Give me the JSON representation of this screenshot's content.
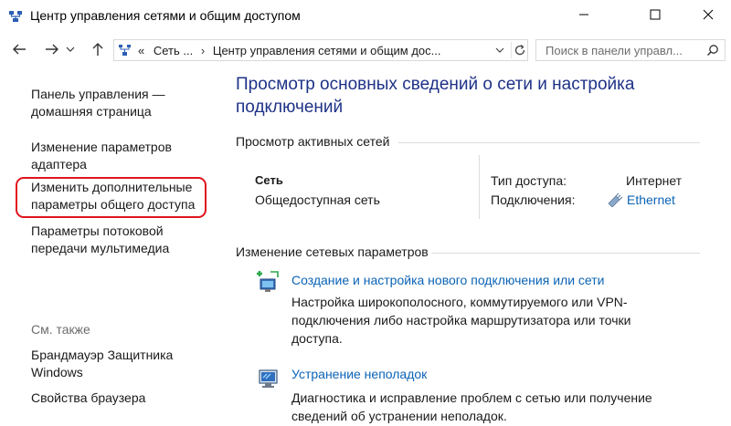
{
  "window": {
    "title": "Центр управления сетями и общим доступом"
  },
  "nav": {
    "breadcrumb_prefix": "«",
    "breadcrumb_1": "Сеть ...",
    "breadcrumb_sep": "›",
    "breadcrumb_2": "Центр управления сетями и общим дос...",
    "search_placeholder": "Поиск в панели управл..."
  },
  "sidebar": {
    "home": "Панель управления — домашняя страница",
    "adapter": "Изменение параметров адаптера",
    "sharing": "Изменить дополнительные параметры общего доступа",
    "streaming": "Параметры потоковой передачи мультимедиа",
    "see_also": "См. также",
    "firewall": "Брандмауэр Защитника Windows",
    "browser": "Свойства браузера"
  },
  "main": {
    "heading": "Просмотр основных сведений о сети и настройка подключений",
    "active_networks_title": "Просмотр активных сетей",
    "network_name": "Сеть",
    "network_category": "Общедоступная сеть",
    "access_type_label": "Тип доступа:",
    "access_type_value": "Интернет",
    "connections_label": "Подключения:",
    "connections_value": "Ethernet",
    "change_settings_title": "Изменение сетевых параметров",
    "task1_title": "Создание и настройка нового подключения или сети",
    "task1_desc": "Настройка широкополосного, коммутируемого или VPN-подключения либо настройка маршрутизатора или точки доступа.",
    "task2_title": "Устранение неполадок",
    "task2_desc": "Диагностика и исправление проблем с сетью или получение сведений об устранении неполадок."
  },
  "colors": {
    "heading": "#1e3287",
    "link": "#0b63b6",
    "highlight": "#e0141e"
  },
  "icons": [
    "network-center-icon",
    "back-arrow-icon",
    "forward-arrow-icon",
    "chevron-down-icon",
    "up-arrow-icon",
    "control-panel-icon",
    "refresh-icon",
    "search-icon",
    "minimize-icon",
    "maximize-icon",
    "close-icon",
    "ethernet-icon",
    "new-connection-icon",
    "troubleshoot-icon"
  ]
}
